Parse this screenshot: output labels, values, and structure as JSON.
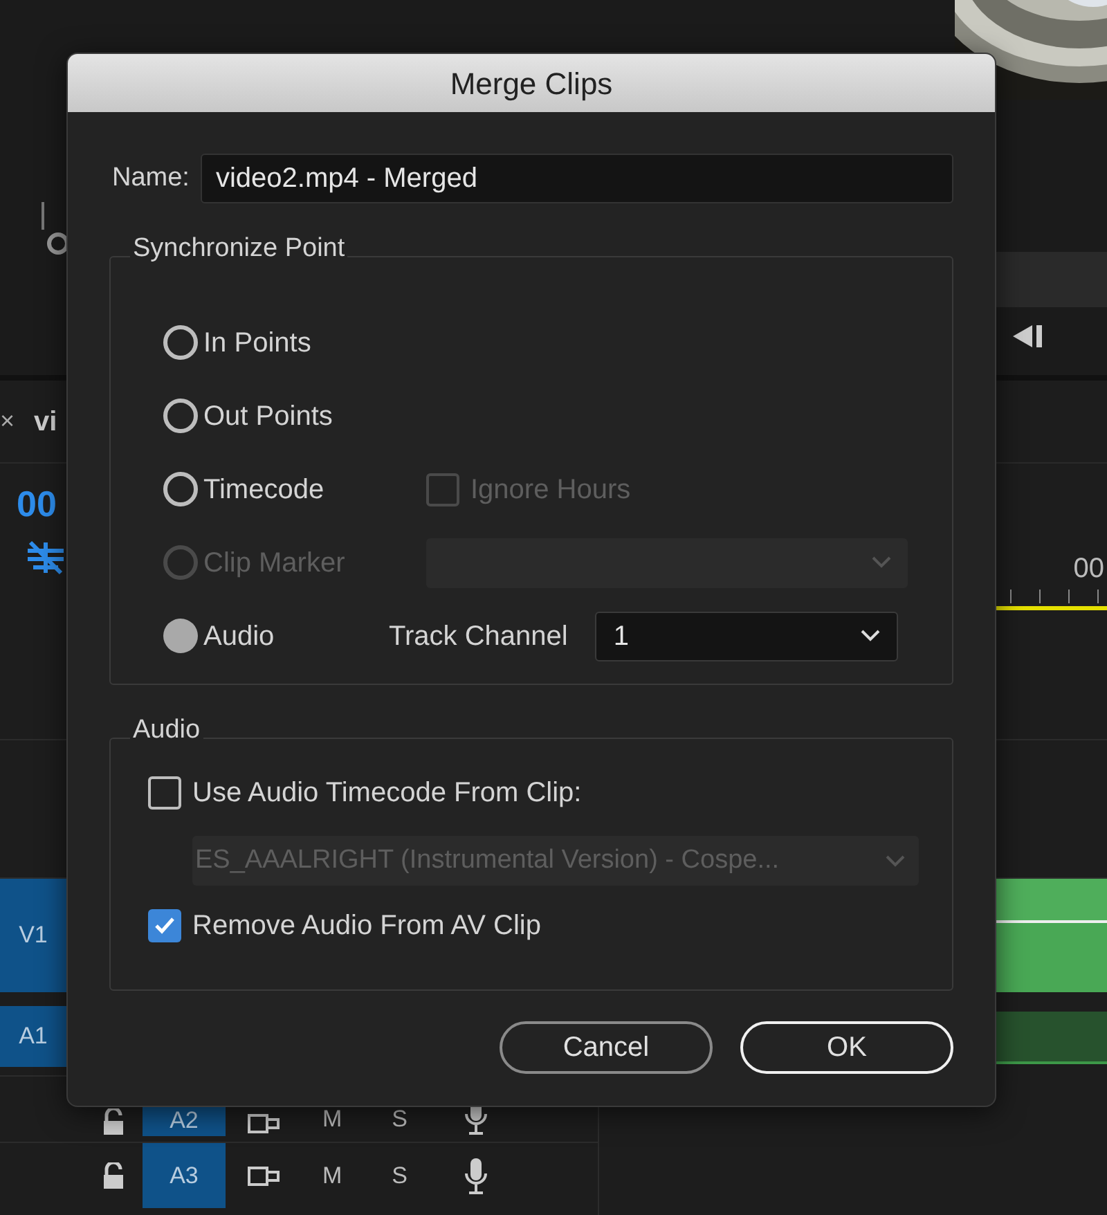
{
  "background": {
    "tab": {
      "close": "×",
      "title": "vi"
    },
    "timecode": "00",
    "ruler_timecode": "00",
    "tracks": [
      {
        "label": "V1",
        "kind": "video"
      },
      {
        "label": "A1",
        "kind": "audio"
      },
      {
        "label": "A2",
        "kind": "audio",
        "mute": "M",
        "solo": "S"
      },
      {
        "label": "A3",
        "kind": "audio",
        "mute": "M",
        "solo": "S"
      }
    ]
  },
  "dialog": {
    "title": "Merge Clips",
    "name_label": "Name:",
    "name_value": "video2.mp4 - Merged",
    "sync": {
      "legend": "Synchronize Point",
      "options": [
        {
          "label": "In Points",
          "selected": false,
          "disabled": false
        },
        {
          "label": "Out Points",
          "selected": false,
          "disabled": false
        },
        {
          "label": "Timecode",
          "selected": false,
          "disabled": false,
          "checkbox": {
            "label": "Ignore Hours",
            "checked": false,
            "disabled": true
          }
        },
        {
          "label": "Clip Marker",
          "selected": false,
          "disabled": true,
          "select": {
            "disabled": true
          }
        },
        {
          "label": "Audio",
          "selected": true,
          "disabled": false,
          "select": {
            "label": "Track Channel",
            "value": "1",
            "disabled": false
          }
        }
      ]
    },
    "audio": {
      "legend": "Audio",
      "use_timecode": {
        "label": "Use Audio Timecode From Clip:",
        "checked": false
      },
      "clip_select": {
        "value": "ES_AAALRIGHT (Instrumental Version) - Cospe...",
        "disabled": true
      },
      "remove_audio": {
        "label": "Remove Audio From AV Clip",
        "checked": true
      }
    },
    "buttons": [
      {
        "label": "Cancel",
        "default": false
      },
      {
        "label": "OK",
        "default": true
      }
    ]
  }
}
